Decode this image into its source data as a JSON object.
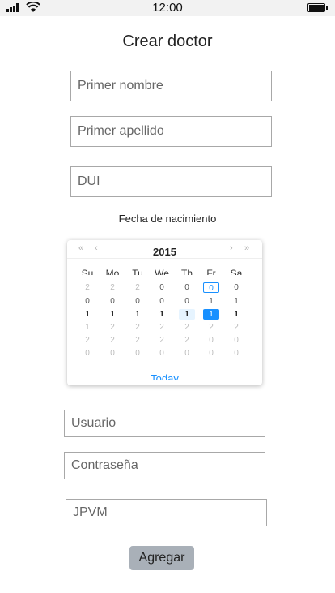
{
  "status_bar": {
    "time": "12:00"
  },
  "title": "Crear doctor",
  "form": {
    "first_name_placeholder": "Primer nombre",
    "last_name_placeholder": "Primer apellido",
    "dui_placeholder": "DUI",
    "dob_label": "Fecha de nacimiento",
    "user_placeholder": "Usuario",
    "password_placeholder": "Contraseña",
    "extra_field_value": "JPVM",
    "submit_label": "Agregar"
  },
  "calendar": {
    "year": "2015",
    "nav": {
      "prev_year": "«",
      "prev_month": "‹",
      "next_month": "›",
      "next_year": "»"
    },
    "weekdays": [
      "Su",
      "Mo",
      "Tu",
      "We",
      "Th",
      "Fr",
      "Sa"
    ],
    "rows": [
      [
        "2",
        "2",
        "2",
        "0",
        "0",
        "0",
        "0"
      ],
      [
        "0",
        "0",
        "0",
        "0",
        "0",
        "1",
        "1"
      ],
      [
        "1",
        "1",
        "1",
        "1",
        "1",
        "1",
        "1"
      ],
      [
        "1",
        "2",
        "2",
        "2",
        "2",
        "2",
        "2"
      ],
      [
        "2",
        "2",
        "2",
        "2",
        "2",
        "0",
        "0"
      ],
      [
        "0",
        "0",
        "0",
        "0",
        "0",
        "0",
        "0"
      ]
    ],
    "today_label": "Today"
  }
}
